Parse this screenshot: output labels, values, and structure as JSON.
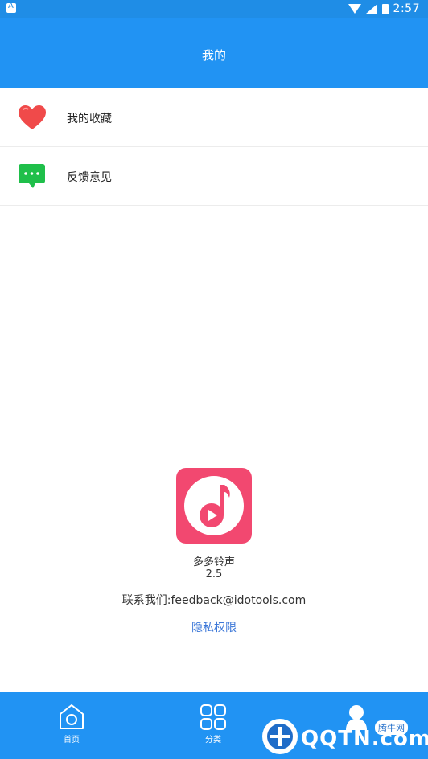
{
  "status_bar": {
    "time": "2:57"
  },
  "header": {
    "title": "我的"
  },
  "menu": {
    "items": [
      {
        "label": "我的收藏",
        "icon": "heart-icon"
      },
      {
        "label": "反馈意见",
        "icon": "chat-bubble-icon"
      }
    ]
  },
  "about": {
    "app_name": "多多铃声",
    "version": "2.5",
    "contact": "联系我们:feedback@idotools.com",
    "privacy_link": "隐私权限"
  },
  "bottom_nav": {
    "items": [
      {
        "label": "首页",
        "icon": "home-icon"
      },
      {
        "label": "分类",
        "icon": "grid-icon"
      },
      {
        "label": "",
        "icon": "user-icon"
      }
    ]
  },
  "watermark": {
    "text": "QQTN.com",
    "badge": "腾牛网"
  },
  "colors": {
    "primary": "#2193f3",
    "heart": "#f04a4a",
    "chat": "#1fbf4a",
    "logo": "#f24870",
    "link": "#3d78d8"
  }
}
